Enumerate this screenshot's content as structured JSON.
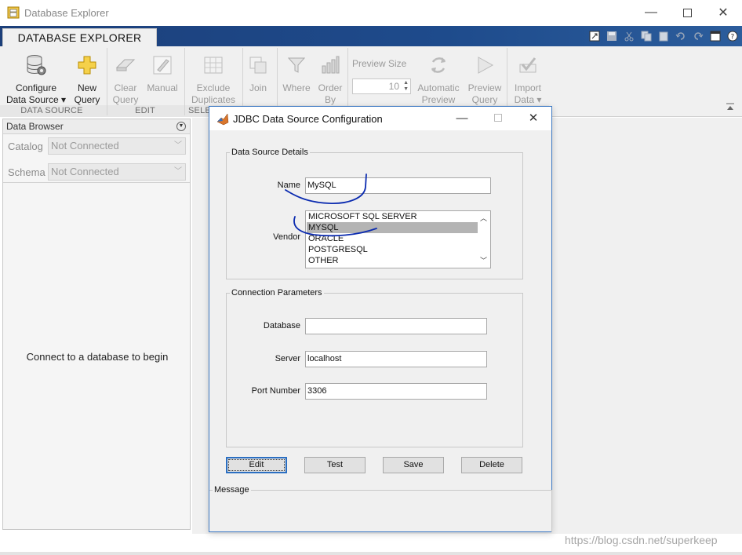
{
  "window": {
    "title": "Database Explorer"
  },
  "ribbon": {
    "tab": "DATABASE EXPLORER",
    "buttons": {
      "configure": [
        "Configure",
        "Data Source ▾"
      ],
      "new_query": [
        "New",
        "Query"
      ],
      "clear_query": [
        "Clear",
        "Query"
      ],
      "manual": [
        "Manual"
      ],
      "exclude_duplicates": [
        "Exclude",
        "Duplicates"
      ],
      "join": [
        "Join"
      ],
      "where": [
        "Where"
      ],
      "order_by": [
        "Order",
        "By"
      ],
      "automatic_preview": [
        "Automatic",
        "Preview"
      ],
      "preview_query": [
        "Preview",
        "Query"
      ],
      "import_data": [
        "Import",
        "Data ▾"
      ]
    },
    "preview_size_label": "Preview Size",
    "preview_size_value": "10",
    "groups": {
      "data_source": "DATA SOURCE",
      "edit": "EDIT",
      "select": "SELE"
    }
  },
  "browser": {
    "header": "Data Browser",
    "catalog_label": "Catalog",
    "catalog_value": "Not Connected",
    "schema_label": "Schema",
    "schema_value": "Not Connected",
    "message": "Connect to a database to begin"
  },
  "dialog": {
    "title": "JDBC Data Source Configuration",
    "details_legend": "Data Source Details",
    "name_label": "Name",
    "name_value": "MySQL",
    "vendor_label": "Vendor",
    "vendors": [
      "MICROSOFT SQL SERVER",
      "MYSQL",
      "ORACLE",
      "POSTGRESQL",
      "OTHER"
    ],
    "selected_vendor": "MYSQL",
    "conn_legend": "Connection Parameters",
    "database_label": "Database",
    "database_value": "",
    "server_label": "Server",
    "server_value": "localhost",
    "port_label": "Port Number",
    "port_value": "3306",
    "buttons": {
      "edit": "Edit",
      "test": "Test",
      "save": "Save",
      "delete": "Delete"
    },
    "message_legend": "Message"
  },
  "watermark": "https://blog.csdn.net/superkeep",
  "colors": {
    "ribbon_blue": "#1e4b8c",
    "dialog_border": "#3c78c3",
    "ink": "#0b2bb0"
  },
  "icons": [
    "app-icon",
    "minimize-icon",
    "maximize-icon",
    "close-icon",
    "database-gear-icon",
    "plus-icon",
    "eraser-icon",
    "pencil-icon",
    "grid-icon",
    "join-icon",
    "filter-icon",
    "bars-icon",
    "refresh-icon",
    "play-icon",
    "checkmark-icon"
  ]
}
